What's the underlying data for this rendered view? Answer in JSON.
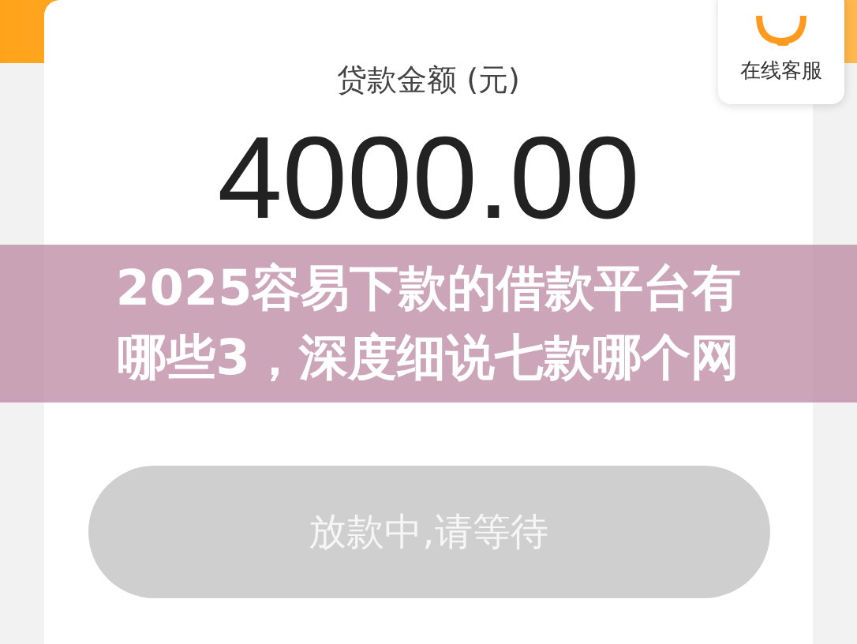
{
  "support": {
    "label": "在线客服"
  },
  "amount": {
    "label": "贷款金额 (元)",
    "value": "4000.00"
  },
  "banner": {
    "lines": [
      "2025容易下款的借款平台有",
      "哪些3，深度细说七款哪个网"
    ]
  },
  "action_button": {
    "label": "放款中,请等待",
    "disabled": true
  }
}
